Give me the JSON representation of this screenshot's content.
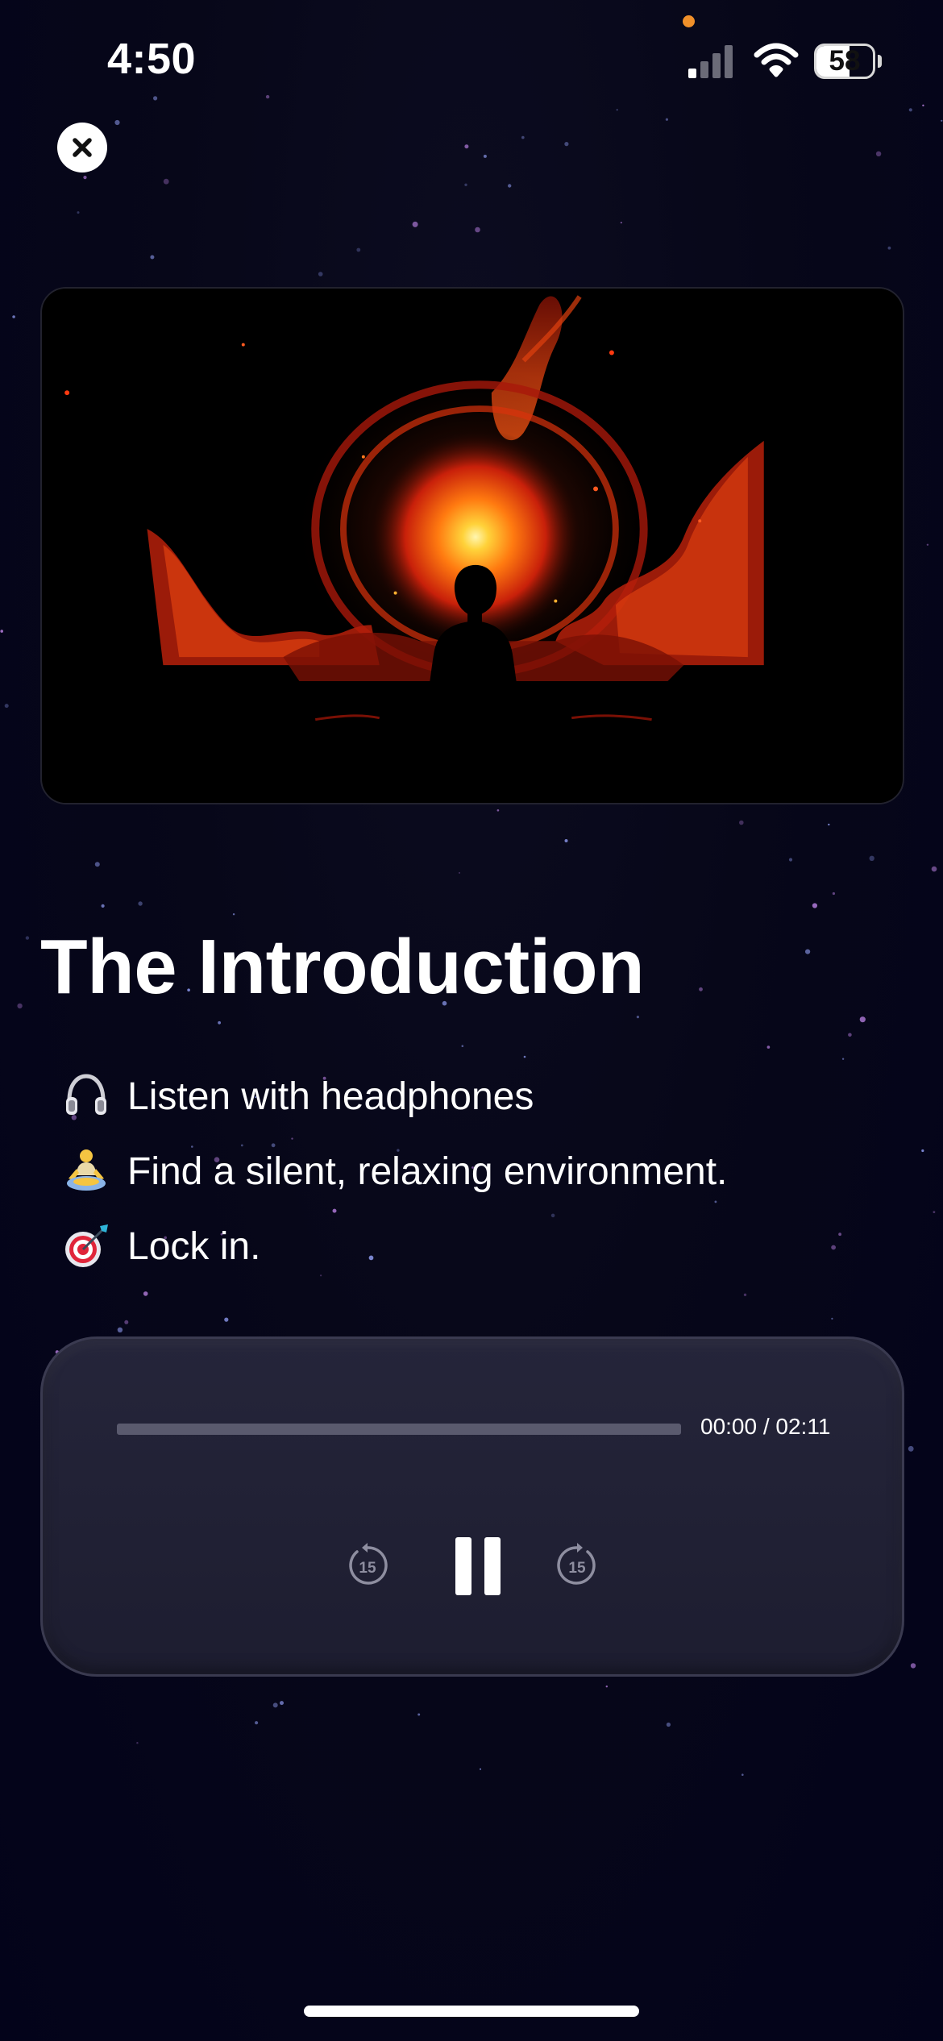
{
  "status_bar": {
    "time": "4:50",
    "battery_level": "58",
    "battery_fraction": 0.58,
    "signal_icon": "cellular-signal-icon",
    "wifi_icon": "wifi-icon"
  },
  "close_icon": "close-icon",
  "artwork": {
    "subject": "meditating-silhouette-cosmic-fire-image"
  },
  "title": "The Introduction",
  "tips": [
    {
      "icon": "headphones-icon",
      "text": "Listen with headphones"
    },
    {
      "icon": "meditation-icon",
      "text": "Find a silent, relaxing environment."
    },
    {
      "icon": "target-icon",
      "text": "Lock in."
    }
  ],
  "player": {
    "progress_fraction": 0.0,
    "time_readout": "00:00 / 02:11",
    "skip_back_label": "15",
    "skip_forward_label": "15",
    "skip_back_icon": "rewind-15-icon",
    "pause_icon": "pause-icon",
    "skip_forward_icon": "forward-15-icon"
  },
  "colors": {
    "background": "#070719",
    "player_surface": "#1f1f33",
    "accent": "#ffffff",
    "recording_dot": "#f0902a"
  }
}
